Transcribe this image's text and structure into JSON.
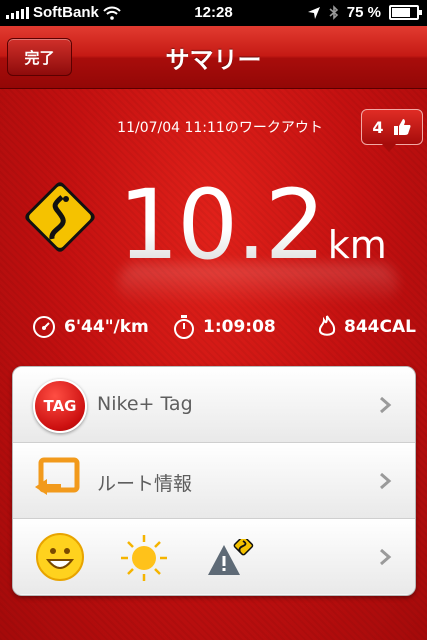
{
  "status_bar": {
    "carrier": "SoftBank",
    "time": "12:28",
    "battery": "75 %"
  },
  "nav": {
    "done_label": "完了",
    "title": "サマリー"
  },
  "workout": {
    "date_label": "11/07/04 11:11のワークアウト",
    "kudos_count": "4",
    "distance_value": "10.2",
    "distance_unit": "km",
    "pace": "6'44\"/km",
    "duration": "1:09:08",
    "calories": "844CAL"
  },
  "rows": {
    "tag": {
      "label": "Nike+ Tag",
      "icon_text": "TAG"
    },
    "route": {
      "label": "ルート情報"
    }
  },
  "colors": {
    "accent": "#c40f0f",
    "sign_yellow": "#f5c200"
  }
}
